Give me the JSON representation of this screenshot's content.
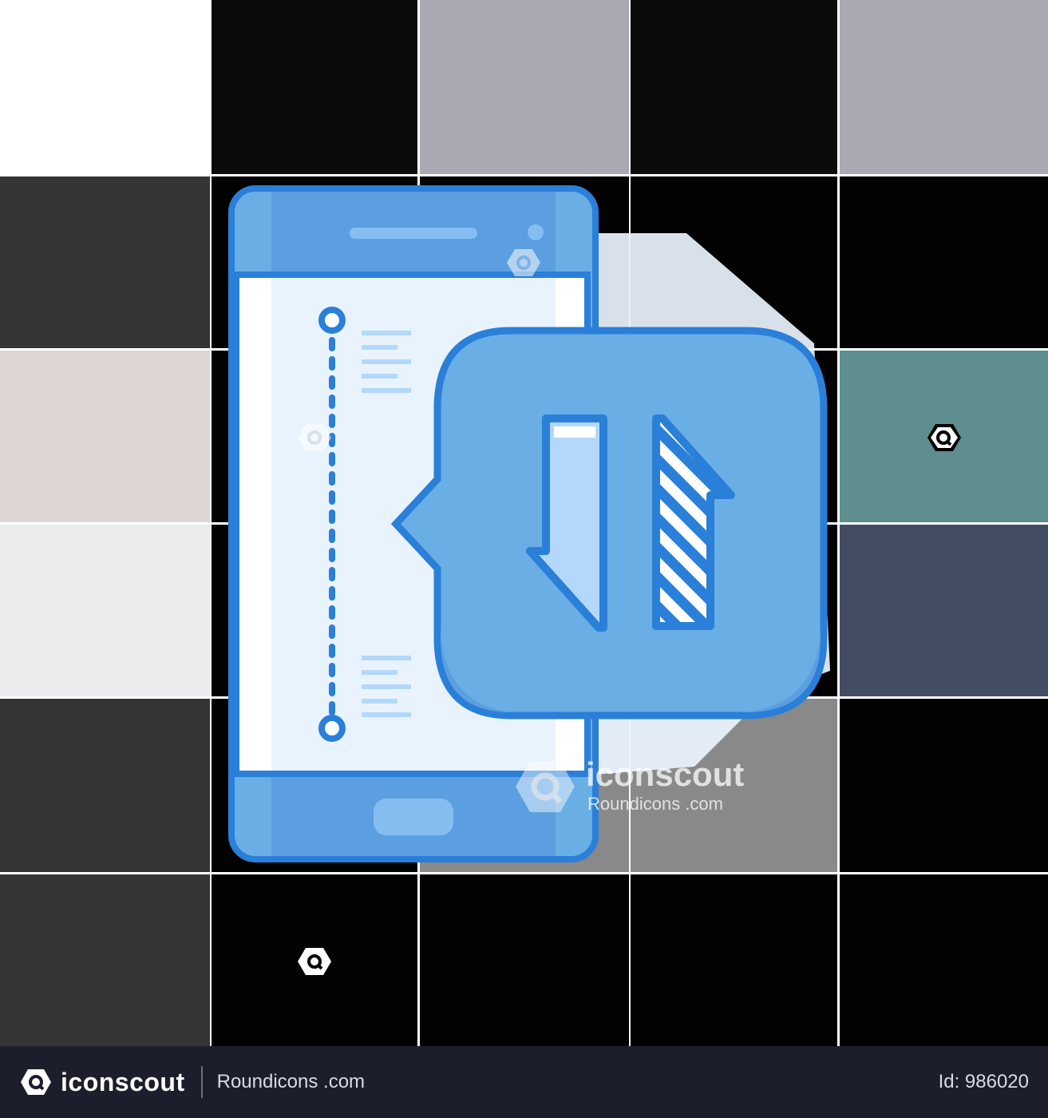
{
  "watermark": {
    "brand": "iconscout",
    "author": "Roundicons .com",
    "logo_icon": "iconscout-logo-icon"
  },
  "footer": {
    "brand": "iconscout",
    "author": "Roundicons .com",
    "asset_id": "Id: 986020"
  },
  "icon": {
    "subject": "phone-with-swap-arrows-icon",
    "colors": {
      "outline": "#2a7fd8",
      "fill": "#6aaee6",
      "fill_dark": "#5b9fe0",
      "screen": "#e8f3fd",
      "accent_light": "#b3d8fb"
    }
  }
}
